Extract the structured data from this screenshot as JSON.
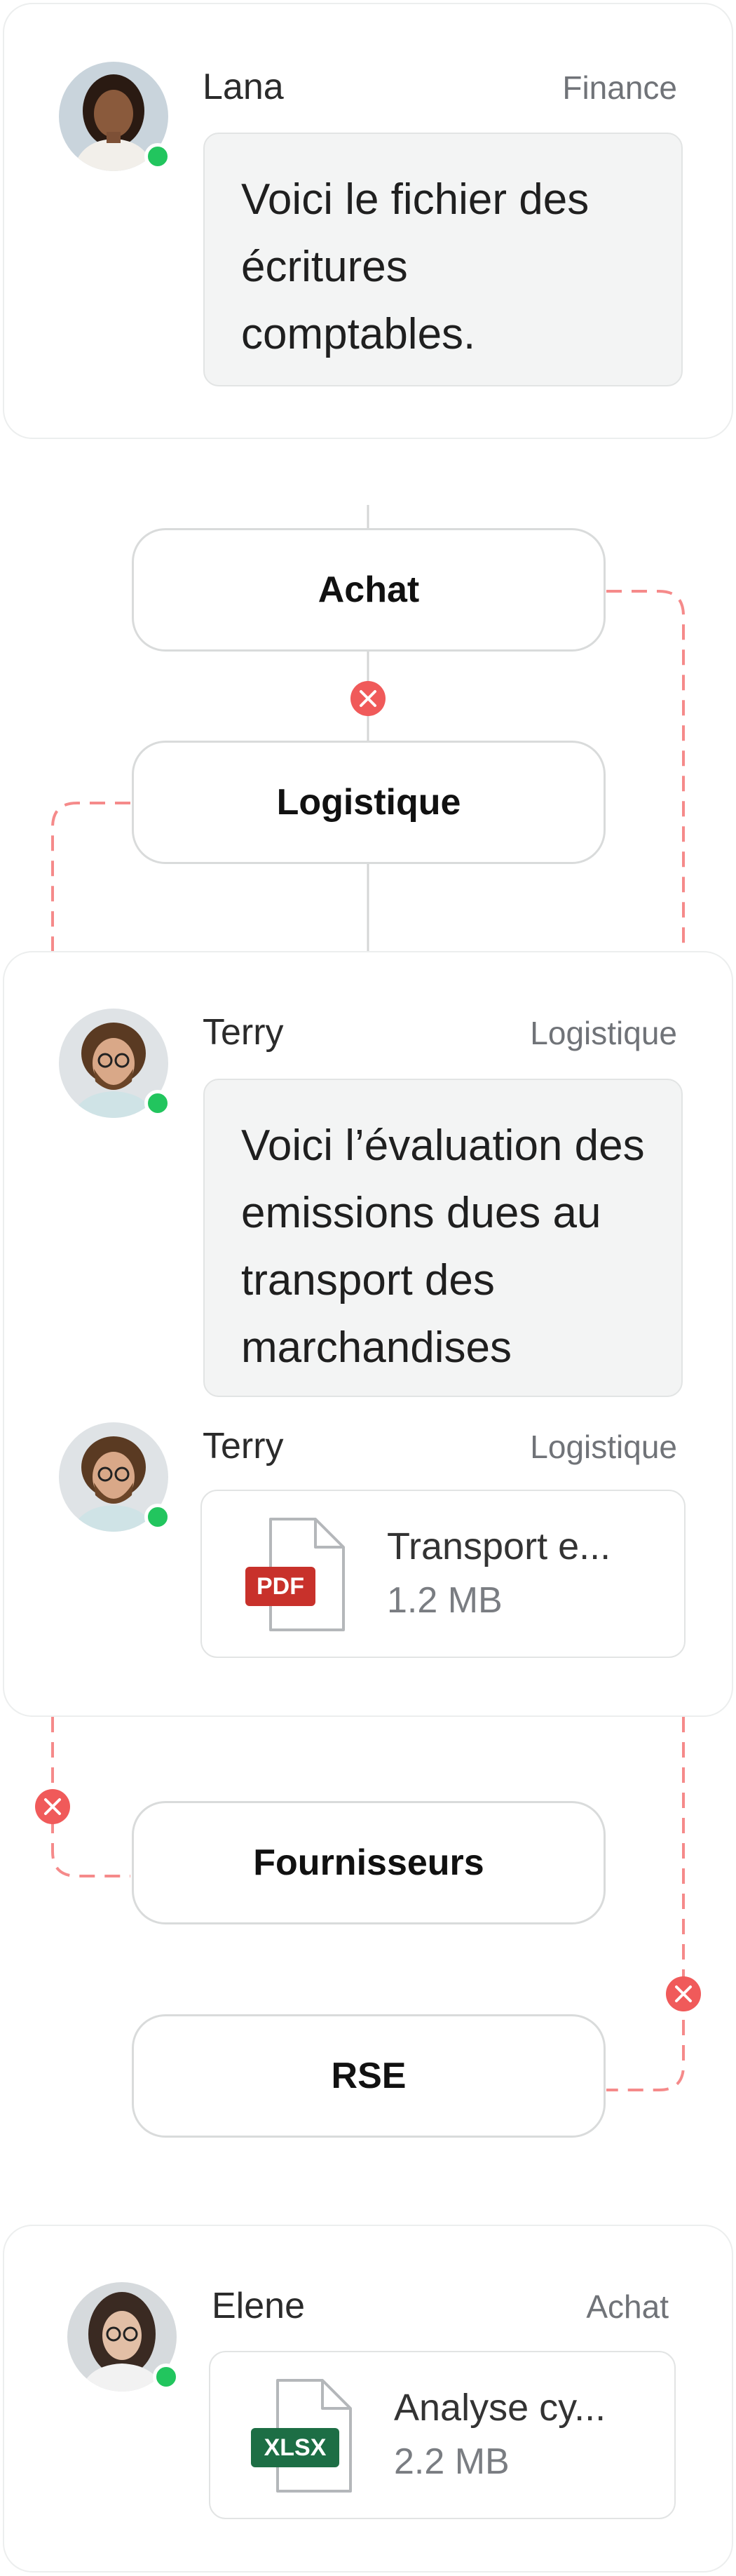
{
  "colors": {
    "accent_error": "#f05a5a",
    "online": "#22c55e",
    "connector": "#d4d6d6"
  },
  "messages": [
    {
      "name": "Lana",
      "department": "Finance",
      "text": "Voici le fichier des écritures comptables."
    },
    {
      "name": "Terry",
      "department": "Logistique",
      "text": "Voici l’évaluation des emissions dues au transport des marchandises"
    },
    {
      "name": "Terry",
      "department": "Logistique",
      "file": {
        "name": "Transport e...",
        "size": "1.2 MB",
        "type": "PDF",
        "icon": "pdf-file-icon"
      }
    },
    {
      "name": "Elene",
      "department": "Achat",
      "file": {
        "name": "Analyse cy...",
        "size": "2.2 MB",
        "type": "XLSX",
        "icon": "xlsx-file-icon"
      }
    }
  ],
  "flow": {
    "nodes": [
      "Achat",
      "Logistique",
      "Fournisseurs",
      "RSE"
    ],
    "error_icon": "close-circle-icon"
  }
}
